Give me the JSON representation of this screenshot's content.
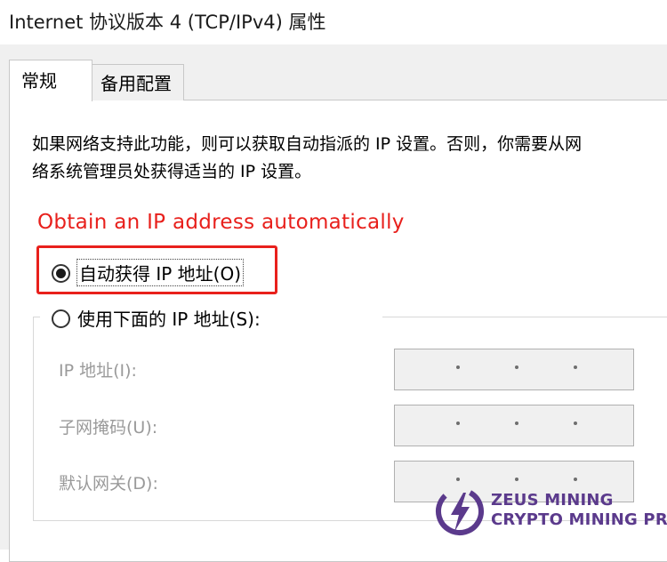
{
  "window": {
    "title": "Internet 协议版本 4 (TCP/IPv4) 属性"
  },
  "tabs": [
    {
      "label": "常规",
      "active": true
    },
    {
      "label": "备用配置",
      "active": false
    }
  ],
  "general": {
    "description_line1": "如果网络支持此功能，则可以获取自动指派的 IP 设置。否则，你需要从网",
    "description_line2": "络系统管理员处获得适当的 IP 设置。",
    "annotation": "Obtain an IP address automatically",
    "annotation_color": "#e8201c",
    "auto_ip_label": "自动获得 IP 地址(O)",
    "auto_ip_selected": true,
    "manual_ip_label": "使用下面的 IP 地址(S):",
    "manual_ip_selected": false,
    "fields": [
      {
        "label": "IP 地址(I):",
        "value": ". . ."
      },
      {
        "label": "子网掩码(U):",
        "value": ". . ."
      },
      {
        "label": "默认网关(D):",
        "value": ". . ."
      }
    ]
  },
  "watermark": {
    "line1": "ZEUS MINING",
    "line2": "CRYPTO MINING PRO",
    "icon": "lightning-bolt-logo-icon",
    "color": "#5b3a8c"
  }
}
